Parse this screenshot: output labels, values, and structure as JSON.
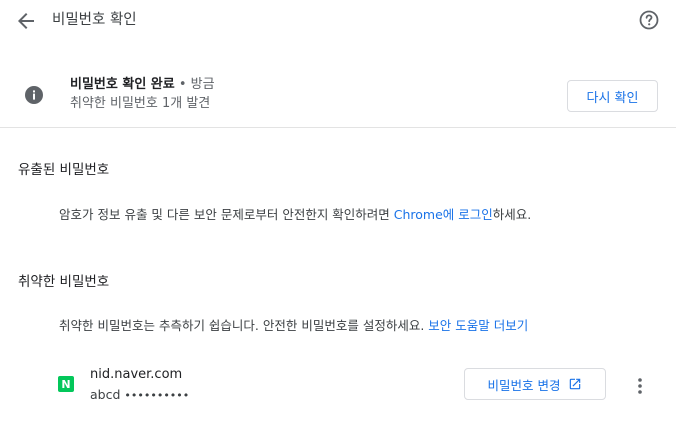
{
  "header": {
    "title": "비밀번호 확인"
  },
  "status": {
    "main": "비밀번호 확인 완료",
    "separator": " • ",
    "time": "방금",
    "detail": "취약한 비밀번호 1개 발견",
    "recheck_label": "다시 확인"
  },
  "leaked": {
    "title": "유출된 비밀번호",
    "body_prefix": "암호가 정보 유출 및 다른 보안 문제로부터 안전한지 확인하려면 ",
    "body_link": "Chrome에 로그인",
    "body_suffix": "하세요."
  },
  "weak": {
    "title": "취약한 비밀번호",
    "body_prefix": "취약한 비밀번호는 추측하기 쉽습니다. 안전한 비밀번호를 설정하세요. ",
    "body_link": "보안 도움말 더보기",
    "items": [
      {
        "favicon_letter": "N",
        "favicon_color": "#03c75a",
        "site": "nid.naver.com",
        "username": "abcd",
        "password_mask": "••••••••••",
        "change_label": "비밀번호 변경"
      }
    ]
  },
  "icons": {
    "back": "arrow-back-icon",
    "help": "help-circle-icon",
    "info": "info-icon",
    "external": "open-in-new-icon",
    "more": "more-vert-icon"
  },
  "colors": {
    "accent": "#1a73e8",
    "naver_green": "#03c75a"
  }
}
